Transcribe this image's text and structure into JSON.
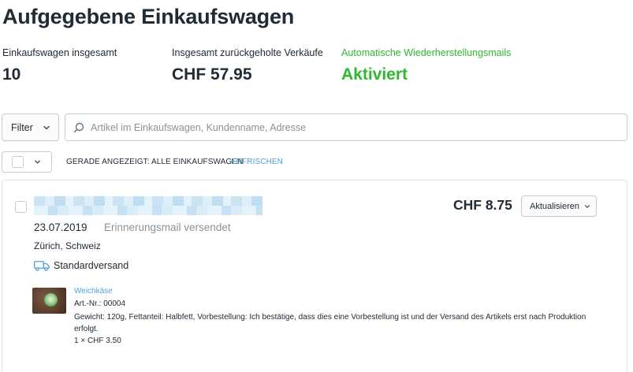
{
  "page": {
    "title": "Aufgegebene Einkaufswagen"
  },
  "stats": [
    {
      "label": "Einkaufswagen insgesamt",
      "value": "10"
    },
    {
      "label": "Insgesamt zurückgeholte Verkäufe",
      "value": "CHF 57.95"
    },
    {
      "label": "Automatische Wiederherstellungsmails",
      "value": "Aktiviert"
    }
  ],
  "toolbar": {
    "filter_label": "Filter",
    "search_placeholder": "Artikel im Einkaufswagen, Kundenname, Adresse",
    "search_value": "",
    "showing_label": "GERADE ANGEZEIGT: ALLE EINKAUFSWAGEN",
    "refresh_label": "ERFRISCHEN"
  },
  "colors": {
    "accent_green": "#2eb82e",
    "link_blue": "#4fa3d8",
    "border": "#c4cdd5"
  },
  "icons": {
    "filter": "chevron-down-icon",
    "search": "search-icon",
    "shipping": "truck-icon"
  },
  "cart": {
    "date": "23.07.2019",
    "status": "Erinnerungsmail versendet",
    "location": "Zürich, Schweiz",
    "shipping": "Standardversand",
    "price": "CHF 8.75",
    "action_label": "Aktualisieren",
    "product": {
      "name": "Weichkäse",
      "sku": "Art.-Nr.: 00004",
      "description": "Gewicht: 120g, Fettanteil: Halbfett, Vorbestellung: Ich bestätige, dass dies eine Vorbestellung ist und der Versand des Artikels erst nach Produktion erfolgt.",
      "quantity": "1 × CHF 3.50"
    }
  }
}
